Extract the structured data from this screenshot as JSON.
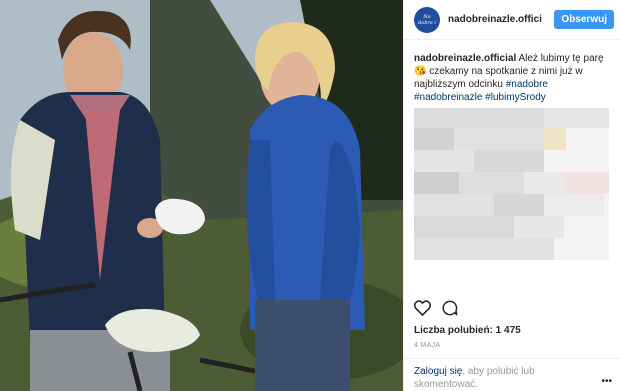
{
  "post": {
    "username": "nadobreinazle.offici",
    "avatar_text": "Na dobre i na złe",
    "follow_label": "Obserwuj",
    "caption_user": "nadobreinazle.official",
    "caption_text": " Ależ lubimy tę parę😘 czekamy na spotkanie z nimi już w najbliższym odcinku ",
    "tag1": "#nadobre",
    "tag2": "#nadobreinazle",
    "tag3": "#lubimySrody",
    "likes": "Liczba polubień: 1 475",
    "date": "4 MAJA",
    "login_link": "Zaloguj się",
    "login_text": ", aby polubić lub skomentować.",
    "more": "•••"
  },
  "icons": {
    "like": "heart-outline-icon",
    "comment": "comment-bubble-icon"
  },
  "colors": {
    "follow_button": "#3897f0",
    "hashtag": "#003569"
  }
}
